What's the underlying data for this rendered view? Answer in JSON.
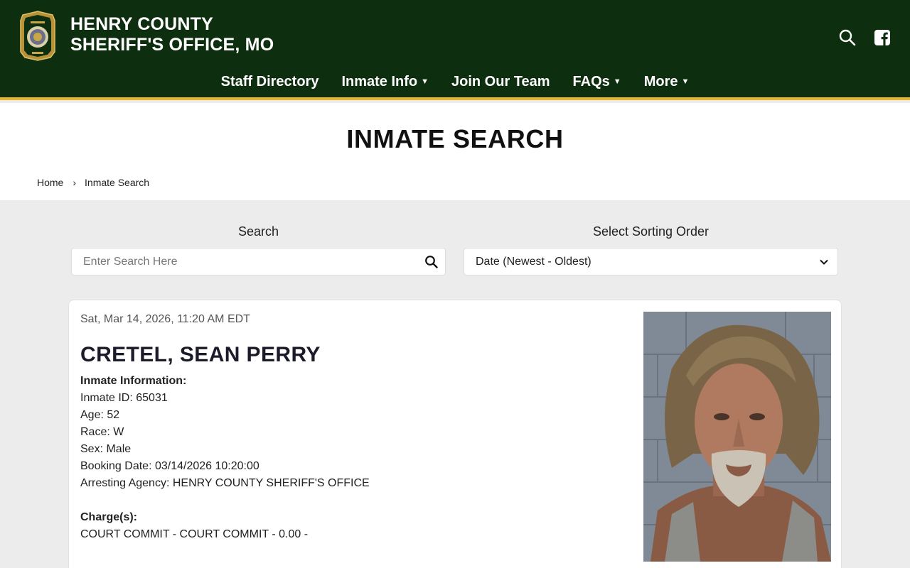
{
  "header": {
    "title_line1": "HENRY COUNTY",
    "title_line2": "SHERIFF'S OFFICE, MO",
    "seal_icon": "sheriff-seal-icon",
    "search_icon": "search-icon",
    "facebook_icon": "facebook-icon",
    "brand_color": "#0e2f0f",
    "accent_color": "#e7b52c"
  },
  "nav": {
    "items": [
      {
        "label": "Staff Directory",
        "dropdown": false
      },
      {
        "label": "Inmate Info",
        "dropdown": true
      },
      {
        "label": "Join Our Team",
        "dropdown": false
      },
      {
        "label": "FAQs",
        "dropdown": true
      },
      {
        "label": "More",
        "dropdown": true
      }
    ]
  },
  "page": {
    "title": "INMATE SEARCH",
    "breadcrumb": [
      "Home",
      "Inmate Search"
    ]
  },
  "search": {
    "label": "Search",
    "placeholder": "Enter Search Here",
    "value": ""
  },
  "sort": {
    "label": "Select Sorting Order",
    "selected": "Date (Newest - Oldest)"
  },
  "inmate": {
    "timestamp": "Sat, Mar 14, 2026, 11:20 AM EDT",
    "name": "CRETEL, SEAN PERRY",
    "info_heading": "Inmate Information:",
    "fields": [
      "Inmate ID: 65031",
      "Age: 52",
      "Race: W",
      "Sex: Male",
      "Booking Date: 03/14/2026 10:20:00",
      "Arresting Agency: HENRY COUNTY SHERIFF'S OFFICE"
    ],
    "charges_heading": "Charge(s):",
    "charges": [
      "COURT COMMIT - COURT COMMIT - 0.00 -"
    ]
  }
}
